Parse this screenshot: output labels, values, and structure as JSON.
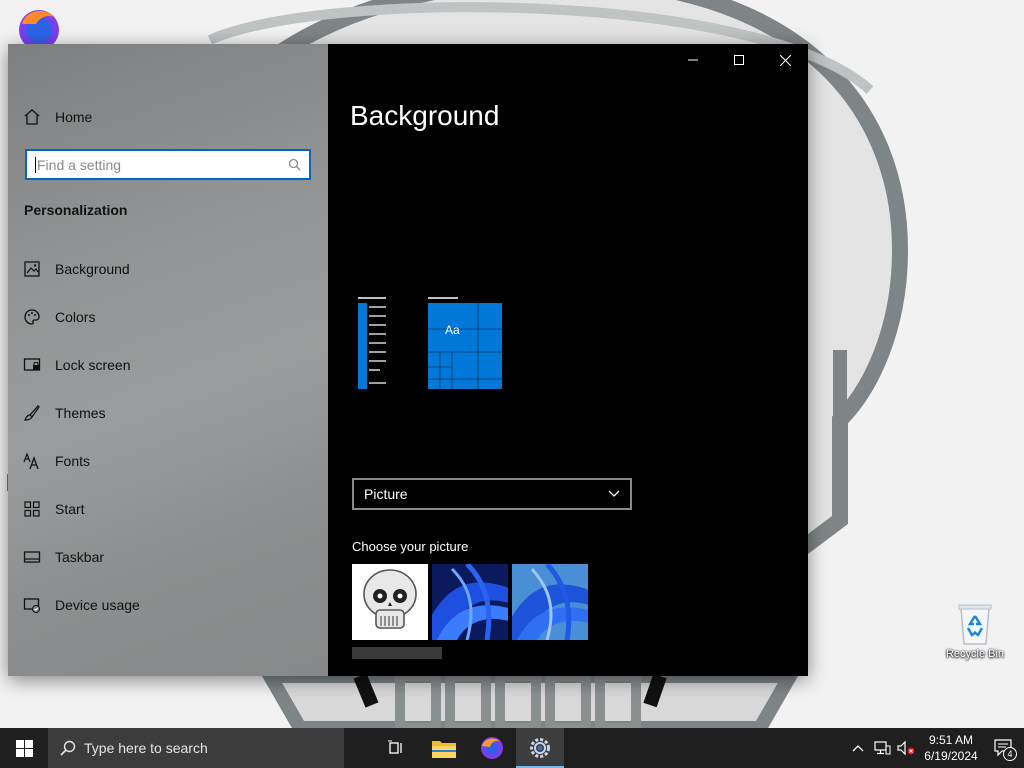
{
  "desktop": {
    "icons": [
      {
        "name": "Recycle Bin",
        "icon": "recycle-bin-icon"
      }
    ]
  },
  "window": {
    "controls": {
      "minimize": "minimize-icon",
      "maximize": "maximize-icon",
      "close": "close-icon"
    }
  },
  "sidebar": {
    "home_label": "Home",
    "search_placeholder": "Find a setting",
    "section_title": "Personalization",
    "items": [
      {
        "label": "Background",
        "icon": "picture-icon"
      },
      {
        "label": "Colors",
        "icon": "palette-icon"
      },
      {
        "label": "Lock screen",
        "icon": "lock-screen-icon"
      },
      {
        "label": "Themes",
        "icon": "brush-icon"
      },
      {
        "label": "Fonts",
        "icon": "fonts-icon"
      },
      {
        "label": "Start",
        "icon": "start-icon"
      },
      {
        "label": "Taskbar",
        "icon": "taskbar-icon"
      },
      {
        "label": "Device usage",
        "icon": "device-usage-icon"
      }
    ]
  },
  "main": {
    "title": "Background",
    "preview_sample_text": "Aa",
    "background_type": {
      "selected": "Picture"
    },
    "choose_picture_label": "Choose your picture",
    "pictures": [
      "skull",
      "blue-bloom-1",
      "blue-bloom-2"
    ]
  },
  "taskbar": {
    "search_placeholder": "Type here to search",
    "apps": [
      "task-view-icon",
      "file-explorer-icon",
      "firefox-icon",
      "settings-icon"
    ],
    "clock": {
      "time": "9:51 AM",
      "date": "6/19/2024"
    },
    "notification_count": "4"
  },
  "colors": {
    "accent": "#0078d7",
    "taskbar": "#1f1f1f",
    "content_bg": "#000000"
  }
}
